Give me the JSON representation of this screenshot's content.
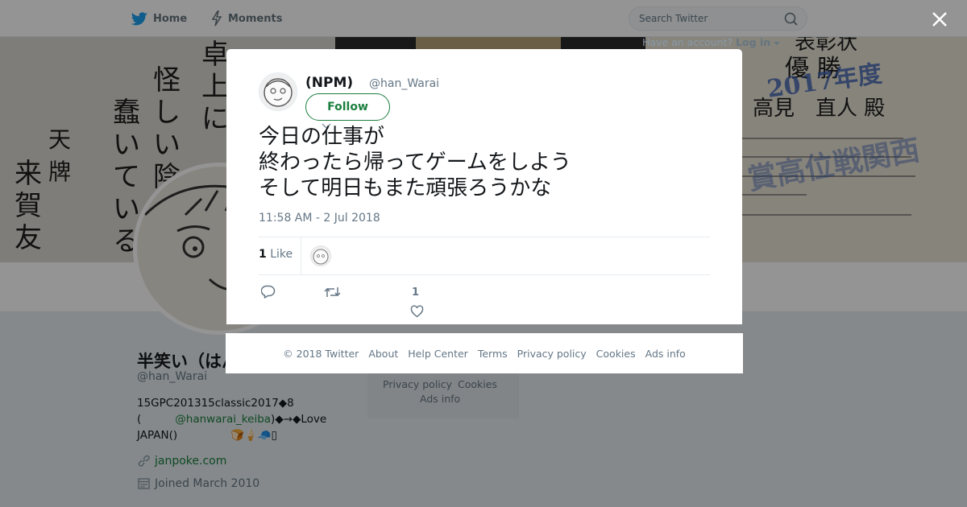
{
  "nav": {
    "home_label": "Home",
    "moments_label": "Moments",
    "search_placeholder": "Search Twitter",
    "login_prefix": "Have an account?",
    "login_label": "Log in"
  },
  "profile": {
    "name": "半笑い（はんわらい）·「",
    "handle": "@han_Warai",
    "bio_line1": "15GPC201315classic2017◆8",
    "bio_line2_prefix": "(",
    "bio_mention": "@hanwarai_keiba",
    "bio_line2_suffix": ")◆→◆Love",
    "bio_line3": "JAPAN()",
    "bio_emoji": "🍞🍦🧢▯",
    "website": "janpoke.com",
    "joined": "Joined March 2010"
  },
  "side_card": {
    "privacy": "Privacy policy",
    "cookies": "Cookies",
    "ads_info": "Ads info"
  },
  "tweet": {
    "name": "(NPM)",
    "handle": "@han_Warai",
    "follow_label": "Follow",
    "text_lines": [
      "今日の仕事が",
      "終わったら帰ってゲームをしよう",
      "そして明日もまた頑張ろうかな"
    ],
    "timestamp": "11:58 AM - 2 Jul 2018",
    "like_count": "1",
    "like_label": "Like",
    "action_like_count": "1"
  },
  "footer": {
    "copyright": "© 2018 Twitter",
    "links": [
      "About",
      "Help Center",
      "Terms",
      "Privacy policy",
      "Cookies",
      "Ads info"
    ]
  },
  "header_art": {
    "left_text": "卓上には怪しい陰が蠢いている",
    "cert_title": "優勝",
    "cert_year": "2017年度",
    "cert_name": "高見 直人 殿",
    "cert_top": "表彰状"
  },
  "colors": {
    "accent": "#1b7f3f",
    "twitter_blue": "#1da1f2",
    "overlay": "rgba(0,0,0,0.42)"
  }
}
